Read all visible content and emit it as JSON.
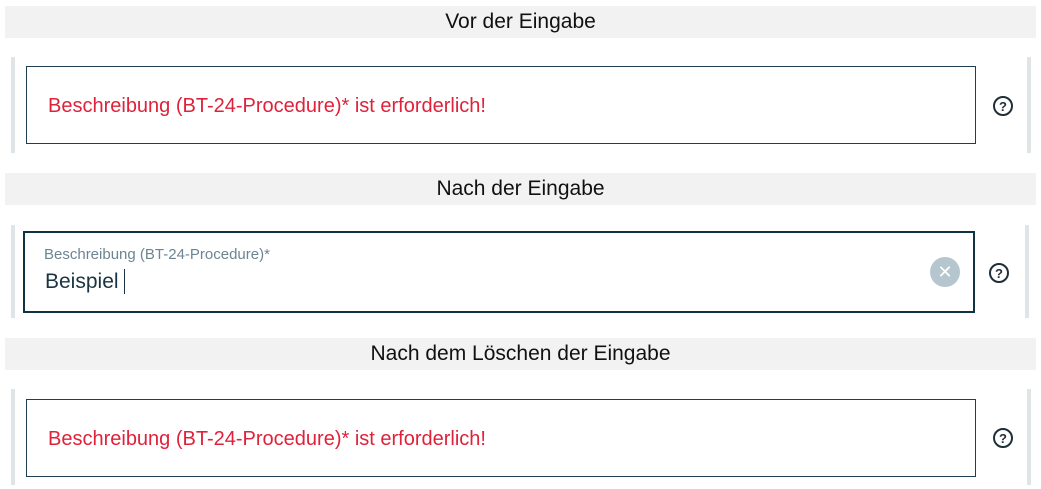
{
  "sections": [
    {
      "caption": "Vor der Eingabe",
      "field": {
        "error": "Beschreibung (BT-24-Procedure)* ist erforderlich!"
      }
    },
    {
      "caption": "Nach der Eingabe",
      "field": {
        "label": "Beschreibung (BT-24-Procedure)*",
        "value": "Beispiel"
      }
    },
    {
      "caption": "Nach dem Löschen der Eingabe",
      "field": {
        "error": "Beschreibung (BT-24-Procedure)* ist erforderlich!"
      }
    }
  ],
  "icons": {
    "help": "question-mark-icon",
    "clear": "close-circle-icon"
  },
  "glyphs": {
    "help": "?",
    "clear": "✕"
  },
  "colors": {
    "error": "#e0213a",
    "border": "#1f3f50",
    "label": "#6c8592",
    "clear_button": "#b6c6ce",
    "caption_bg": "#f2f2f2"
  }
}
